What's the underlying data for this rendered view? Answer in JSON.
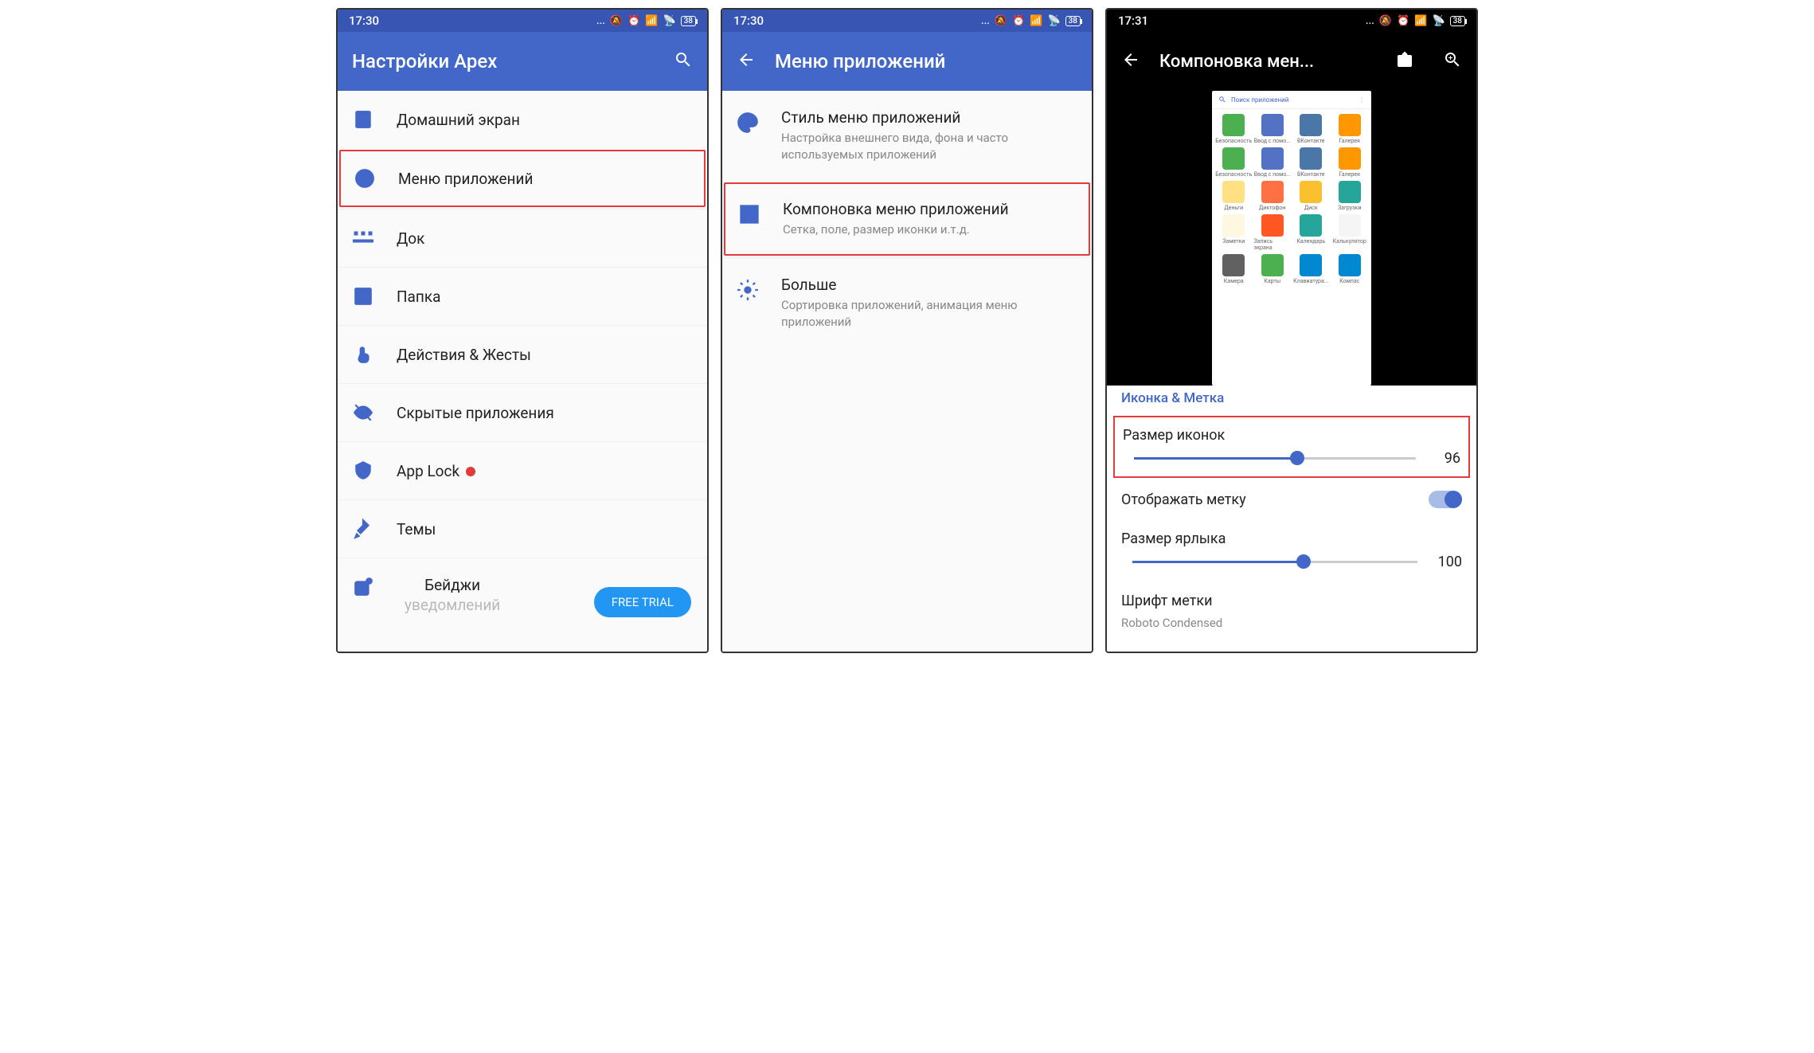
{
  "screen1": {
    "status": {
      "time": "17:30",
      "battery": "38"
    },
    "title": "Настройки Apex",
    "items": [
      {
        "label": "Домашний экран"
      },
      {
        "label": "Меню приложений",
        "highlighted": true
      },
      {
        "label": "Док"
      },
      {
        "label": "Папка"
      },
      {
        "label": "Действия & Жесты"
      },
      {
        "label": "Скрытые приложения"
      },
      {
        "label": "App Lock",
        "dot": true
      },
      {
        "label": "Темы"
      },
      {
        "label": "Бейджи",
        "label2": "уведомлений",
        "trial": "FREE TRIAL"
      }
    ]
  },
  "screen2": {
    "status": {
      "time": "17:30",
      "battery": "38"
    },
    "title": "Меню приложений",
    "items": [
      {
        "label": "Стиль меню приложений",
        "sub": "Настройка внешнего вида, фона и часто используемых приложений"
      },
      {
        "label": "Компоновка меню приложений",
        "sub": "Сетка, поле, размер иконки и.т.д.",
        "highlighted": true
      },
      {
        "label": "Больше",
        "sub": "Сортировка приложений, анимация меню приложений"
      }
    ]
  },
  "screen3": {
    "status": {
      "time": "17:31",
      "battery": "38"
    },
    "title": "Компоновка мен...",
    "preview_search": "Поиск приложений",
    "preview_apps": [
      {
        "name": "Безопасность",
        "color": "#4caf50"
      },
      {
        "name": "Ввод с помо...",
        "color": "#5472c4"
      },
      {
        "name": "ВКонтакте",
        "color": "#4a76a8"
      },
      {
        "name": "Галерея",
        "color": "#ff9800"
      },
      {
        "name": "Безопасность",
        "color": "#4caf50"
      },
      {
        "name": "Ввод с помо...",
        "color": "#5472c4"
      },
      {
        "name": "ВКонтакте",
        "color": "#4a76a8"
      },
      {
        "name": "Галерея",
        "color": "#ff9800"
      },
      {
        "name": "Деньги",
        "color": "#ffe082"
      },
      {
        "name": "Диктофон",
        "color": "#ff7043"
      },
      {
        "name": "Диск",
        "color": "#fbc02d"
      },
      {
        "name": "Загрузки",
        "color": "#26a69a"
      },
      {
        "name": "Заметки",
        "color": "#fff8e1"
      },
      {
        "name": "Запись экрана",
        "color": "#ff5722"
      },
      {
        "name": "Календарь",
        "color": "#26a69a"
      },
      {
        "name": "Калькулятор",
        "color": "#f5f5f5"
      },
      {
        "name": "Камера",
        "color": "#616161"
      },
      {
        "name": "Карты",
        "color": "#4caf50"
      },
      {
        "name": "Клавиатура...",
        "color": "#0288d1"
      },
      {
        "name": "Компас",
        "color": "#0288d1"
      }
    ],
    "section": "Иконка & Метка",
    "icon_size": {
      "label": "Размер иконок",
      "value": "96",
      "percent": 58
    },
    "show_label": "Отображать метку",
    "label_size": {
      "label": "Размер ярлыка",
      "value": "100",
      "percent": 60
    },
    "font": {
      "label": "Шрифт метки",
      "value": "Roboto Condensed"
    }
  }
}
